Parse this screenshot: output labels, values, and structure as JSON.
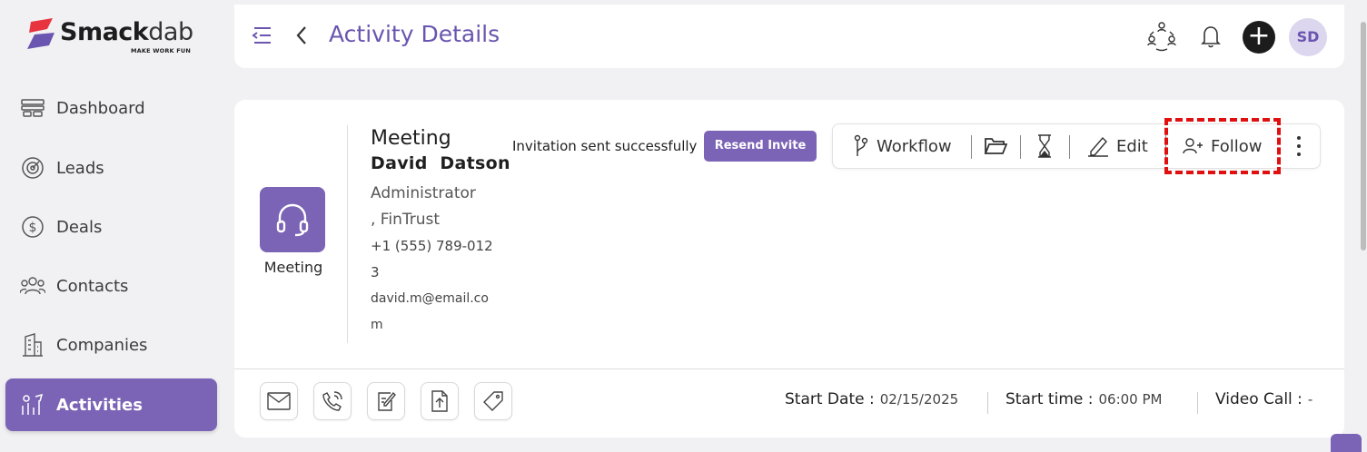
{
  "brand": {
    "name_bold": "Smack",
    "name_light": "dab",
    "tagline": "MAKE WORK FUN"
  },
  "sidebar": {
    "items": [
      {
        "label": "Dashboard",
        "icon": "dashboard-icon",
        "active": false
      },
      {
        "label": "Leads",
        "icon": "target-icon",
        "active": false
      },
      {
        "label": "Deals",
        "icon": "dollar-icon",
        "active": false
      },
      {
        "label": "Contacts",
        "icon": "people-icon",
        "active": false
      },
      {
        "label": "Companies",
        "icon": "building-icon",
        "active": false
      },
      {
        "label": "Activities",
        "icon": "activities-icon",
        "active": true
      }
    ]
  },
  "header": {
    "title": "Activity Details",
    "avatar_initials": "SD"
  },
  "activity": {
    "type_label": "Meeting",
    "title": "Meeting",
    "contact_name": "David  Datson",
    "role": "Administrator",
    "company": ", FinTrust",
    "phone": "+1 (555) 789-0123",
    "email": "david.m@email.com"
  },
  "invite": {
    "status_text": "Invitation sent successfully",
    "resend_label": "Resend Invite"
  },
  "toolbar": {
    "workflow_label": "Workflow",
    "edit_label": "Edit",
    "follow_label": "Follow"
  },
  "details": {
    "start_date_label": "Start Date :",
    "start_date_value": "02/15/2025",
    "start_time_label": "Start time :",
    "start_time_value": "06:00 PM",
    "video_call_label": "Video Call :",
    "video_call_value": "-"
  },
  "colors": {
    "accent": "#7b63b5",
    "title": "#6a55b0",
    "highlight": "#e01010"
  }
}
